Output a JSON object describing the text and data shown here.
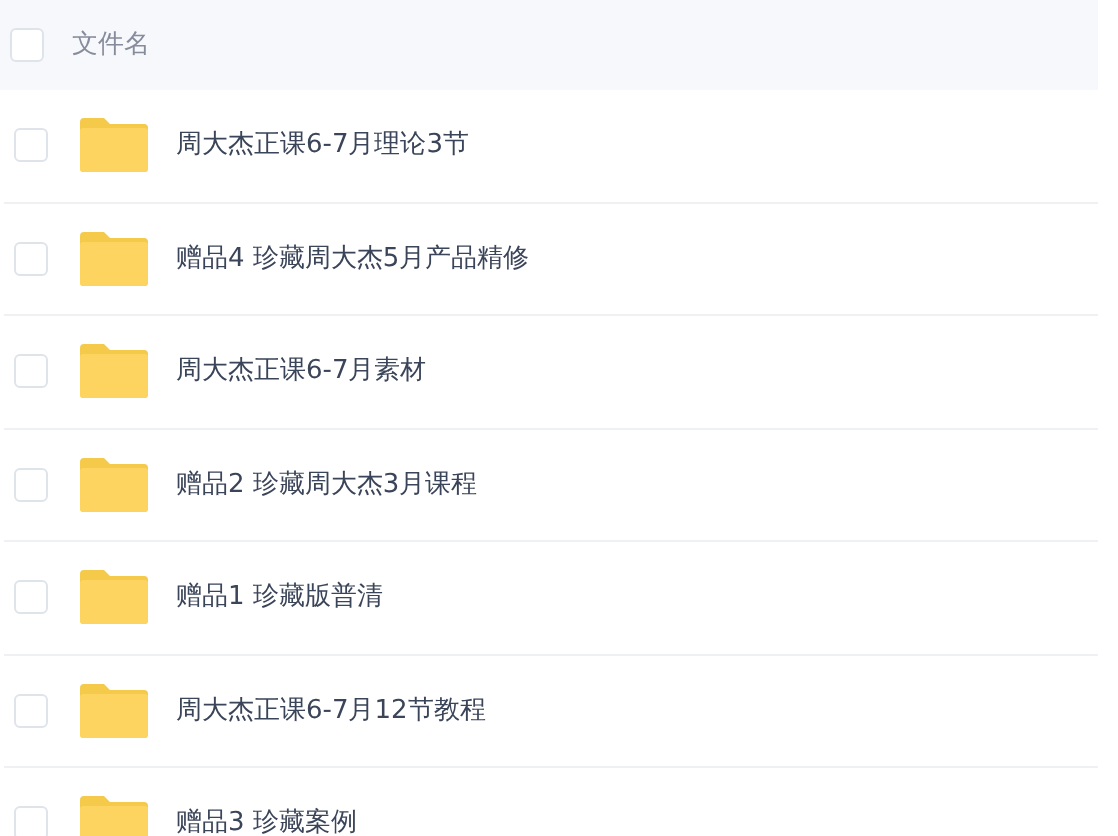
{
  "header": {
    "label": "文件名",
    "checked": false
  },
  "files": [
    {
      "name": "周大杰正课6-7月理论3节",
      "checked": false
    },
    {
      "name": "赠品4 珍藏周大杰5月产品精修",
      "checked": false
    },
    {
      "name": "周大杰正课6-7月素材",
      "checked": false
    },
    {
      "name": "赠品2 珍藏周大杰3月课程",
      "checked": false
    },
    {
      "name": "赠品1 珍藏版普清",
      "checked": false
    },
    {
      "name": "周大杰正课6-7月12节教程",
      "checked": false
    },
    {
      "name": "赠品3 珍藏案例",
      "checked": false
    }
  ]
}
